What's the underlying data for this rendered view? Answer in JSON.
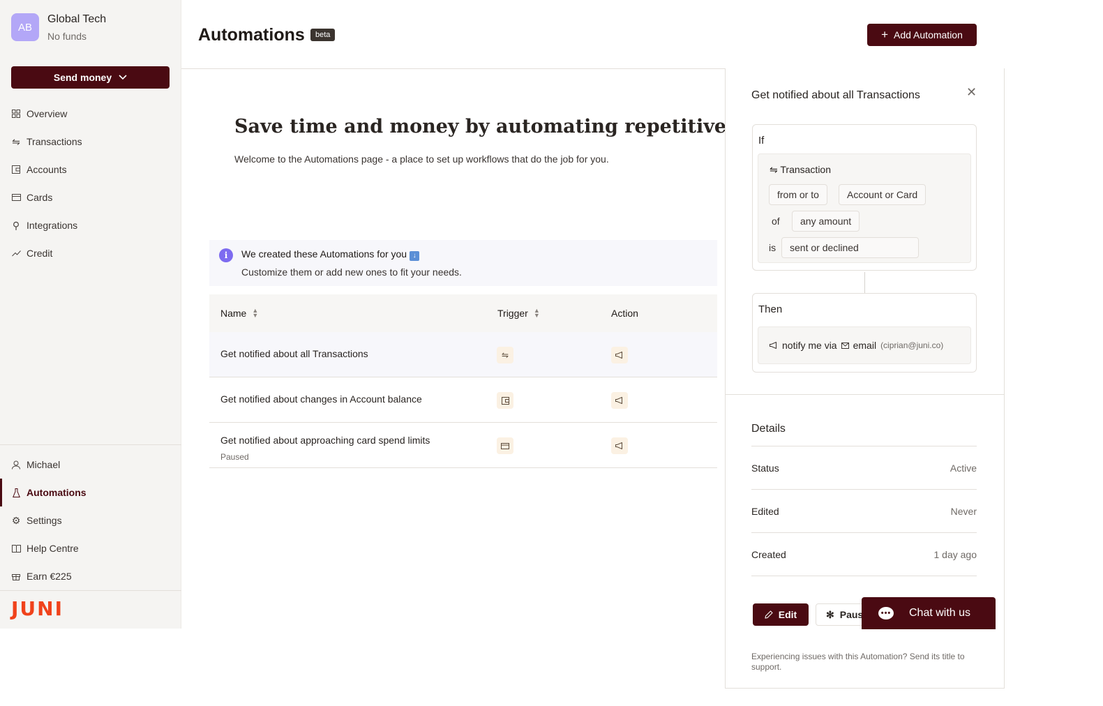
{
  "org": {
    "initials": "AB",
    "name": "Global Tech",
    "sub": "No funds"
  },
  "sidebar": {
    "send_money": "Send money",
    "top_items": [
      {
        "label": "Overview",
        "icon": "grid-icon"
      },
      {
        "label": "Transactions",
        "icon": "transfer-icon"
      },
      {
        "label": "Accounts",
        "icon": "wallet-icon"
      },
      {
        "label": "Cards",
        "icon": "card-icon"
      },
      {
        "label": "Integrations",
        "icon": "plug-icon"
      },
      {
        "label": "Credit",
        "icon": "trend-icon"
      }
    ],
    "bottom_items": [
      {
        "label": "Michael",
        "icon": "user-icon"
      },
      {
        "label": "Automations",
        "icon": "flask-icon",
        "active": true
      },
      {
        "label": "Settings",
        "icon": "gear-icon"
      },
      {
        "label": "Help Centre",
        "icon": "book-icon"
      },
      {
        "label": "Earn €225",
        "icon": "gift-icon"
      }
    ],
    "logo": "JUNI"
  },
  "header": {
    "title": "Automations",
    "badge": "beta",
    "add_button": "Add Automation"
  },
  "hero": {
    "title": "Save time and money by automating repetitive tasks",
    "subtitle": "Welcome to the Automations page - a place to set up workflows that do the job for you."
  },
  "info": {
    "title": "We created these Automations for you",
    "subtitle": "Customize them or add new ones to fit your needs."
  },
  "table": {
    "columns": [
      "Name",
      "Trigger",
      "Action"
    ],
    "rows": [
      {
        "name": "Get notified about all Transactions",
        "status": "",
        "trigger_icon": "transfer-icon",
        "action_icon": "megaphone-icon"
      },
      {
        "name": "Get notified about changes in Account balance",
        "status": "",
        "trigger_icon": "wallet-icon",
        "action_icon": "megaphone-icon"
      },
      {
        "name": "Get notified about approaching card spend limits",
        "status": "Paused",
        "trigger_icon": "card-icon",
        "action_icon": "megaphone-icon"
      }
    ]
  },
  "panel": {
    "title": "Get notified about all Transactions",
    "if_label": "If",
    "condition": {
      "subject": "Transaction",
      "direction": "from or to",
      "target": "Account or Card",
      "of_word": "of",
      "amount": "any amount",
      "is_word": "is",
      "state": "sent or declined"
    },
    "then_label": "Then",
    "action": {
      "text": "notify me via",
      "channel": "email",
      "address": "(ciprian@juni.co)"
    },
    "details_title": "Details",
    "details": [
      {
        "key": "Status",
        "value": "Active"
      },
      {
        "key": "Edited",
        "value": "Never"
      },
      {
        "key": "Created",
        "value": "1 day ago"
      }
    ],
    "edit_button": "Edit",
    "pause_button": "Pause",
    "footnote": "Experiencing issues with this Automation? Send its title to support."
  },
  "chat": {
    "label": "Chat with us"
  },
  "colors": {
    "brand": "#4a0a12",
    "logo": "#f0421b",
    "avatar": "#b3a7f7",
    "info_icon": "#7d6bf0"
  }
}
